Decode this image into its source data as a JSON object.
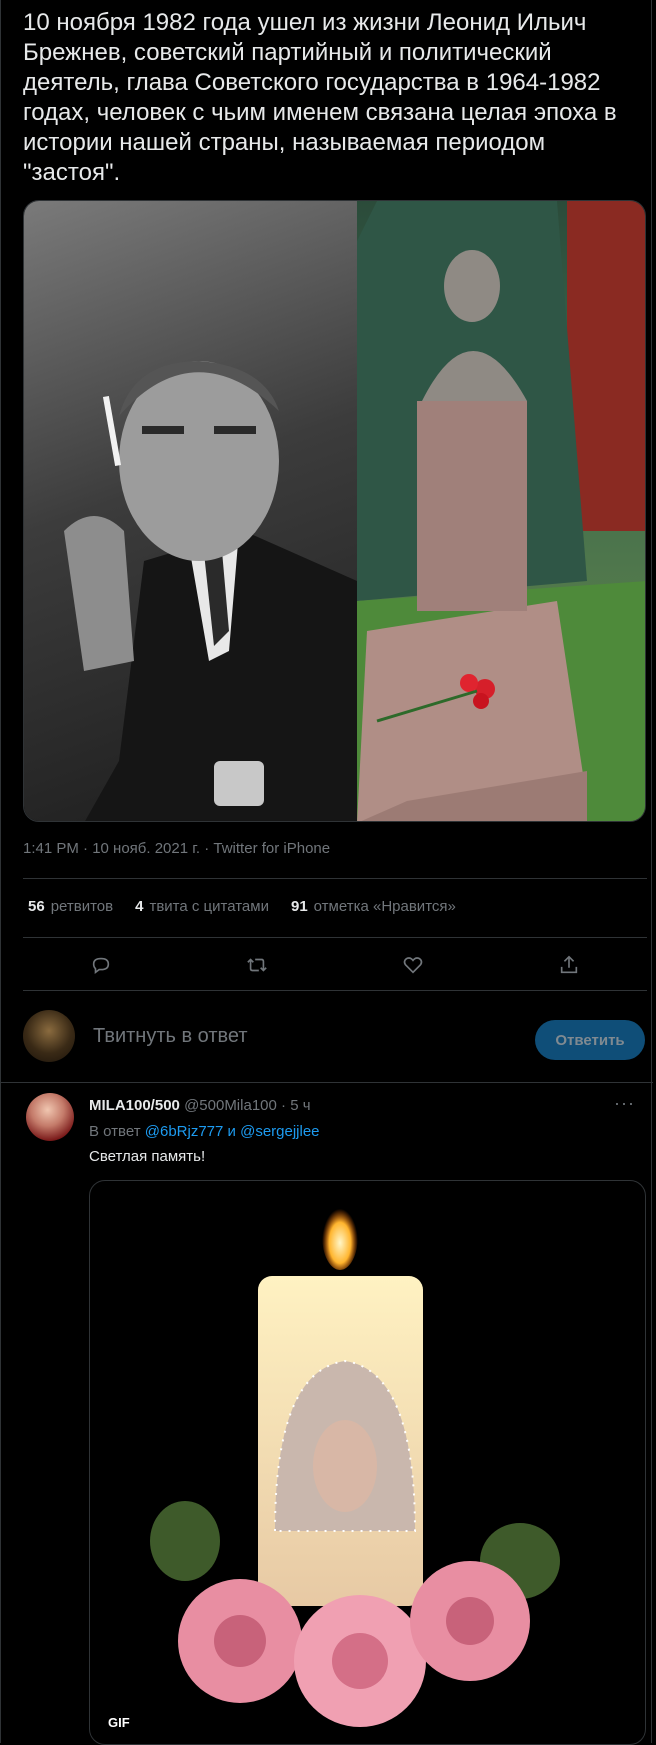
{
  "tweet": {
    "text": "10 ноября 1982 года ушел из жизни Леонид Ильич\nБрежнев, советский партийный и политический\nдеятель, глава Советского государства в 1964-1982\nгодах, человек с чьим именем связана целая эпоха в\nистории нашей страны, называемая периодом\n\"застоя\".",
    "timestamp": "1:41 PM · 10 нояб. 2021 г. · Twitter for iPhone"
  },
  "stats": {
    "retweets_count": "56",
    "retweets_label": "ретвитов",
    "quotes_count": "4",
    "quotes_label": "твита с цитатами",
    "likes_count": "91",
    "likes_label": "отметка «Нравится»"
  },
  "actions": {
    "reply_icon": "reply-icon",
    "retweet_icon": "retweet-icon",
    "like_icon": "heart-icon",
    "share_icon": "share-icon"
  },
  "compose": {
    "placeholder": "Твитнуть в ответ",
    "button": "Ответить"
  },
  "reply": {
    "name": "MILA100/500",
    "handle": "@500Mila100",
    "time": "· 5 ч",
    "more": "···",
    "reply_to_prefix": "В ответ",
    "reply_to_user1": "@6bRjz777",
    "reply_to_and": "и",
    "reply_to_user2": "@sergejjlee",
    "text": "Светлая память!",
    "gif_badge": "GIF"
  },
  "colors": {
    "accent": "#1d9bf0",
    "background": "#000000",
    "text": "#e7e9ea",
    "muted": "#71767b",
    "border": "#2f3336"
  }
}
